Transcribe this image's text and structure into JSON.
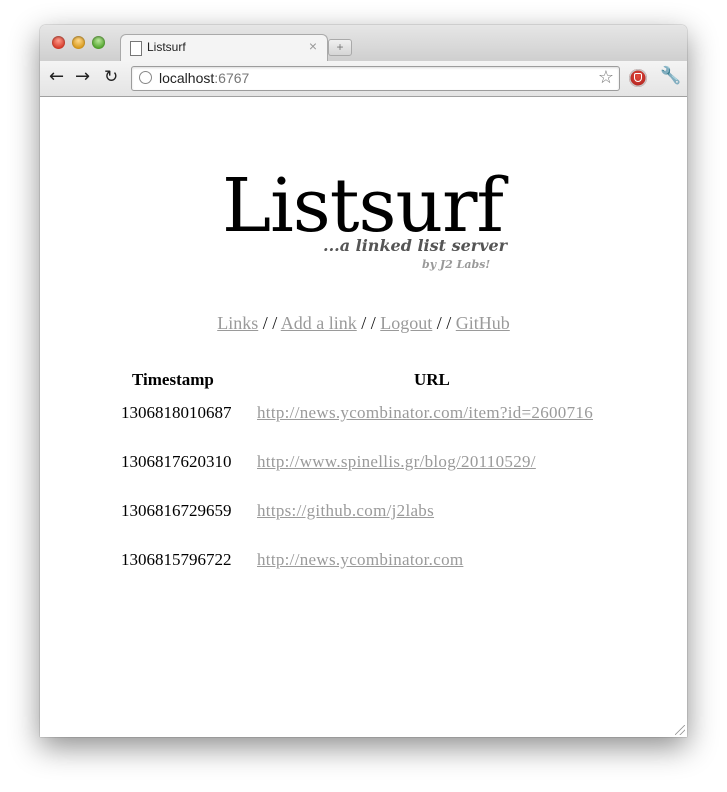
{
  "browser": {
    "tab_title": "Listsurf",
    "tab_close": "×",
    "new_tab": "+",
    "url_host": "localhost",
    "url_port": ":6767",
    "back_icon": "arrow-left",
    "forward_icon": "arrow-right",
    "reload_icon": "reload",
    "bookmark_icon": "star",
    "extension_icon": "adblock",
    "settings_icon": "wrench"
  },
  "page": {
    "logo": "Listsurf",
    "tagline": "...a linked list server",
    "byline": "by J2 Labs!",
    "nav": [
      {
        "label": "Links"
      },
      {
        "label": "Add a link"
      },
      {
        "label": "Logout"
      },
      {
        "label": "GitHub"
      }
    ],
    "separator": "/ /",
    "table": {
      "headers": {
        "timestamp": "Timestamp",
        "url": "URL"
      },
      "rows": [
        {
          "timestamp": "1306818010687",
          "url": "http://news.ycombinator.com/item?id=2600716"
        },
        {
          "timestamp": "1306817620310",
          "url": "http://www.spinellis.gr/blog/20110529/"
        },
        {
          "timestamp": "1306816729659",
          "url": "https://github.com/j2labs"
        },
        {
          "timestamp": "1306815796722",
          "url": "http://news.ycombinator.com"
        }
      ]
    }
  },
  "colors": {
    "link": "#9a9a9a",
    "text": "#000000",
    "tagline": "#555555",
    "byline": "#999999"
  }
}
